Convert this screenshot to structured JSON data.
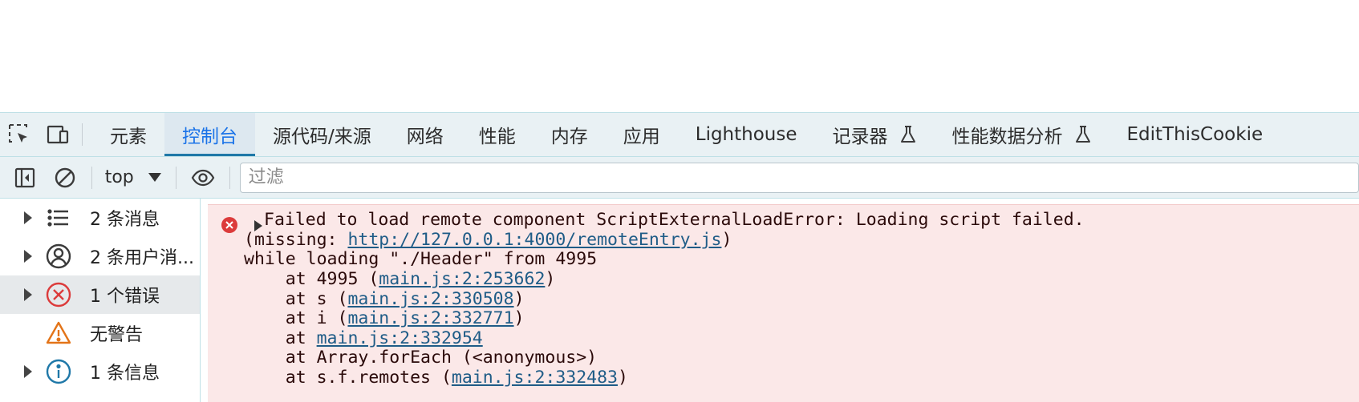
{
  "tabs": [
    {
      "label": "元素",
      "active": false,
      "experimental": false
    },
    {
      "label": "控制台",
      "active": true,
      "experimental": false
    },
    {
      "label": "源代码/来源",
      "active": false,
      "experimental": false
    },
    {
      "label": "网络",
      "active": false,
      "experimental": false
    },
    {
      "label": "性能",
      "active": false,
      "experimental": false
    },
    {
      "label": "内存",
      "active": false,
      "experimental": false
    },
    {
      "label": "应用",
      "active": false,
      "experimental": false
    },
    {
      "label": "Lighthouse",
      "active": false,
      "experimental": false
    },
    {
      "label": "记录器",
      "active": false,
      "experimental": true
    },
    {
      "label": "性能数据分析",
      "active": false,
      "experimental": true
    },
    {
      "label": "EditThisCookie",
      "active": false,
      "experimental": false
    }
  ],
  "toolbar": {
    "context": "top",
    "filter_placeholder": "过滤"
  },
  "sidebar": {
    "items": [
      {
        "label": "2 条消息",
        "icon": "list-icon",
        "expandable": true,
        "selected": false
      },
      {
        "label": "2 条用户消...",
        "icon": "user-icon",
        "expandable": true,
        "selected": false
      },
      {
        "label": "1 个错误",
        "icon": "error-icon",
        "expandable": true,
        "selected": true
      },
      {
        "label": "无警告",
        "icon": "warning-icon",
        "expandable": false,
        "selected": false
      },
      {
        "label": "1 条信息",
        "icon": "info-icon",
        "expandable": true,
        "selected": false
      }
    ]
  },
  "console": {
    "error": {
      "line1": "Failed to load remote component ScriptExternalLoadError: Loading script failed.",
      "line2_prefix": "(missing: ",
      "line2_link": "http://127.0.0.1:4000/remoteEntry.js",
      "line2_suffix": ")",
      "line3": "while loading \"./Header\" from 4995",
      "stack": [
        {
          "prefix": "    at 4995 (",
          "link": "main.js:2:253662",
          "suffix": ")"
        },
        {
          "prefix": "    at s (",
          "link": "main.js:2:330508",
          "suffix": ")"
        },
        {
          "prefix": "    at i (",
          "link": "main.js:2:332771",
          "suffix": ")"
        },
        {
          "prefix": "    at ",
          "link": "main.js:2:332954",
          "suffix": ""
        },
        {
          "prefix": "    at Array.forEach (<anonymous>)",
          "link": "",
          "suffix": ""
        },
        {
          "prefix": "    at s.f.remotes (",
          "link": "main.js:2:332483",
          "suffix": ")"
        }
      ]
    }
  },
  "colors": {
    "accent": "#1a73e8",
    "error_bg": "#fbe8e8",
    "error_icon": "#dc3b3b",
    "warning_icon": "#e37418",
    "info_icon": "#1f78a8"
  }
}
